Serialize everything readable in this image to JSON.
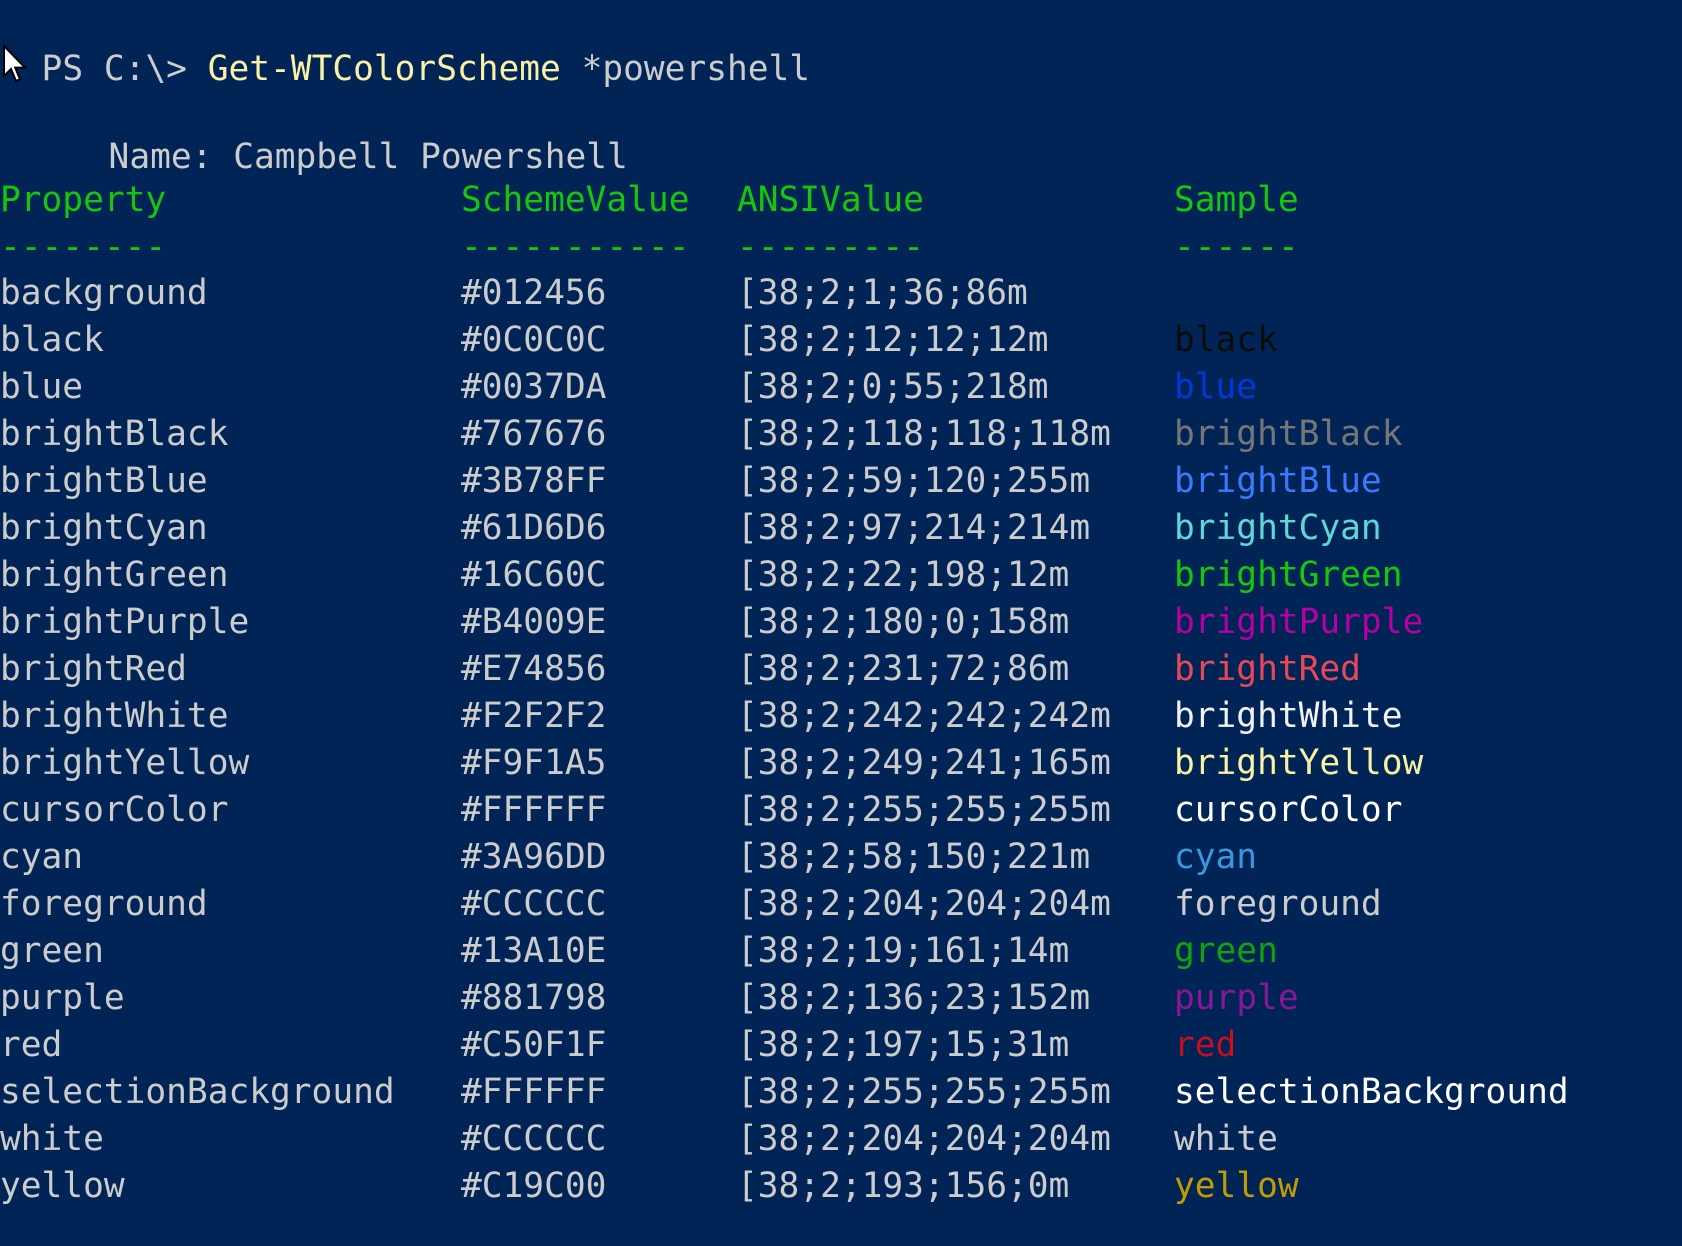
{
  "prompt": {
    "ps": "PS C:\\> ",
    "command": "Get-WTColorScheme",
    "argument": " *powershell"
  },
  "scheme_name": {
    "label": "Name:",
    "value": "Campbell Powershell"
  },
  "table": {
    "headers": {
      "property": "Property",
      "scheme_value": "SchemeValue",
      "ansi_value": "ANSIValue",
      "sample": "Sample"
    },
    "underlines": {
      "property": "--------",
      "scheme_value": "-----------",
      "ansi_value": "---------",
      "sample": "------"
    },
    "rows": [
      {
        "property": "background",
        "scheme_value": "#012456",
        "ansi_value": "[38;2;1;36;86m",
        "sample": "",
        "color": "#012456"
      },
      {
        "property": "black",
        "scheme_value": "#0C0C0C",
        "ansi_value": "[38;2;12;12;12m",
        "sample": "black",
        "color": "#0C0C0C"
      },
      {
        "property": "blue",
        "scheme_value": "#0037DA",
        "ansi_value": "[38;2;0;55;218m",
        "sample": "blue",
        "color": "#0037DA"
      },
      {
        "property": "brightBlack",
        "scheme_value": "#767676",
        "ansi_value": "[38;2;118;118;118m",
        "sample": "brightBlack",
        "color": "#767676"
      },
      {
        "property": "brightBlue",
        "scheme_value": "#3B78FF",
        "ansi_value": "[38;2;59;120;255m",
        "sample": "brightBlue",
        "color": "#3B78FF"
      },
      {
        "property": "brightCyan",
        "scheme_value": "#61D6D6",
        "ansi_value": "[38;2;97;214;214m",
        "sample": "brightCyan",
        "color": "#61D6D6"
      },
      {
        "property": "brightGreen",
        "scheme_value": "#16C60C",
        "ansi_value": "[38;2;22;198;12m",
        "sample": "brightGreen",
        "color": "#16C60C"
      },
      {
        "property": "brightPurple",
        "scheme_value": "#B4009E",
        "ansi_value": "[38;2;180;0;158m",
        "sample": "brightPurple",
        "color": "#B4009E"
      },
      {
        "property": "brightRed",
        "scheme_value": "#E74856",
        "ansi_value": "[38;2;231;72;86m",
        "sample": "brightRed",
        "color": "#E74856"
      },
      {
        "property": "brightWhite",
        "scheme_value": "#F2F2F2",
        "ansi_value": "[38;2;242;242;242m",
        "sample": "brightWhite",
        "color": "#F2F2F2"
      },
      {
        "property": "brightYellow",
        "scheme_value": "#F9F1A5",
        "ansi_value": "[38;2;249;241;165m",
        "sample": "brightYellow",
        "color": "#F9F1A5"
      },
      {
        "property": "cursorColor",
        "scheme_value": "#FFFFFF",
        "ansi_value": "[38;2;255;255;255m",
        "sample": "cursorColor",
        "color": "#FFFFFF"
      },
      {
        "property": "cyan",
        "scheme_value": "#3A96DD",
        "ansi_value": "[38;2;58;150;221m",
        "sample": "cyan",
        "color": "#3A96DD"
      },
      {
        "property": "foreground",
        "scheme_value": "#CCCCCC",
        "ansi_value": "[38;2;204;204;204m",
        "sample": "foreground",
        "color": "#CCCCCC"
      },
      {
        "property": "green",
        "scheme_value": "#13A10E",
        "ansi_value": "[38;2;19;161;14m",
        "sample": "green",
        "color": "#13A10E"
      },
      {
        "property": "purple",
        "scheme_value": "#881798",
        "ansi_value": "[38;2;136;23;152m",
        "sample": "purple",
        "color": "#881798"
      },
      {
        "property": "red",
        "scheme_value": "#C50F1F",
        "ansi_value": "[38;2;197;15;31m",
        "sample": "red",
        "color": "#C50F1F"
      },
      {
        "property": "selectionBackground",
        "scheme_value": "#FFFFFF",
        "ansi_value": "[38;2;255;255;255m",
        "sample": "selectionBackground",
        "color": "#FFFFFF"
      },
      {
        "property": "white",
        "scheme_value": "#CCCCCC",
        "ansi_value": "[38;2;204;204;204m",
        "sample": "white",
        "color": "#CCCCCC"
      },
      {
        "property": "yellow",
        "scheme_value": "#C19C00",
        "ansi_value": "[38;2;193;156;0m",
        "sample": "yellow",
        "color": "#C19C00"
      }
    ]
  },
  "colors": {
    "background": "#012456",
    "text": "#CCCCCC",
    "header": "#16C60C",
    "command": "#F9F1A5"
  }
}
